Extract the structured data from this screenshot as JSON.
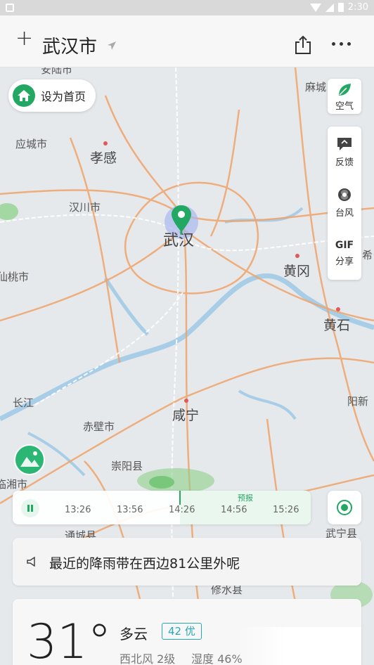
{
  "status_bar": {
    "time": "2:30"
  },
  "header": {
    "add_symbol": "+",
    "city": "武汉市"
  },
  "map": {
    "cities": [
      {
        "name": "安陆市"
      },
      {
        "name": "麻城"
      },
      {
        "name": "应城市"
      },
      {
        "name": "孝感"
      },
      {
        "name": "汉川市"
      },
      {
        "name": "武汉"
      },
      {
        "name": "希"
      },
      {
        "name": "仙桃市"
      },
      {
        "name": "黄冈"
      },
      {
        "name": "黄石"
      },
      {
        "name": "长江"
      },
      {
        "name": "阳新"
      },
      {
        "name": "咸宁"
      },
      {
        "name": "赤壁市"
      },
      {
        "name": "崇阳县"
      },
      {
        "name": "临湘市"
      },
      {
        "name": "通城县"
      },
      {
        "name": "武宁县"
      },
      {
        "name": "修水县"
      }
    ]
  },
  "home_button": {
    "label": "设为首页"
  },
  "tools": {
    "air": {
      "label": "空气"
    },
    "feedback": {
      "label": "反馈"
    },
    "typhoon": {
      "label": "台风"
    },
    "gif": {
      "icon_text": "GIF",
      "label": "分享"
    }
  },
  "timeline": {
    "forecast_label": "预报",
    "ticks": [
      "13:26",
      "13:56",
      "14:26",
      "14:56",
      "15:26"
    ]
  },
  "notice": {
    "text": "最近的降雨带在西边81公里外呢"
  },
  "weather": {
    "temperature": "31°",
    "condition": "多云",
    "aqi": "42 优",
    "wind": "西北风 2级",
    "humidity": "湿度 46%"
  },
  "colors": {
    "accent": "#22a863",
    "road": "#f0a36a",
    "water": "#a8cde6",
    "aqi": "#2aa6b6"
  }
}
